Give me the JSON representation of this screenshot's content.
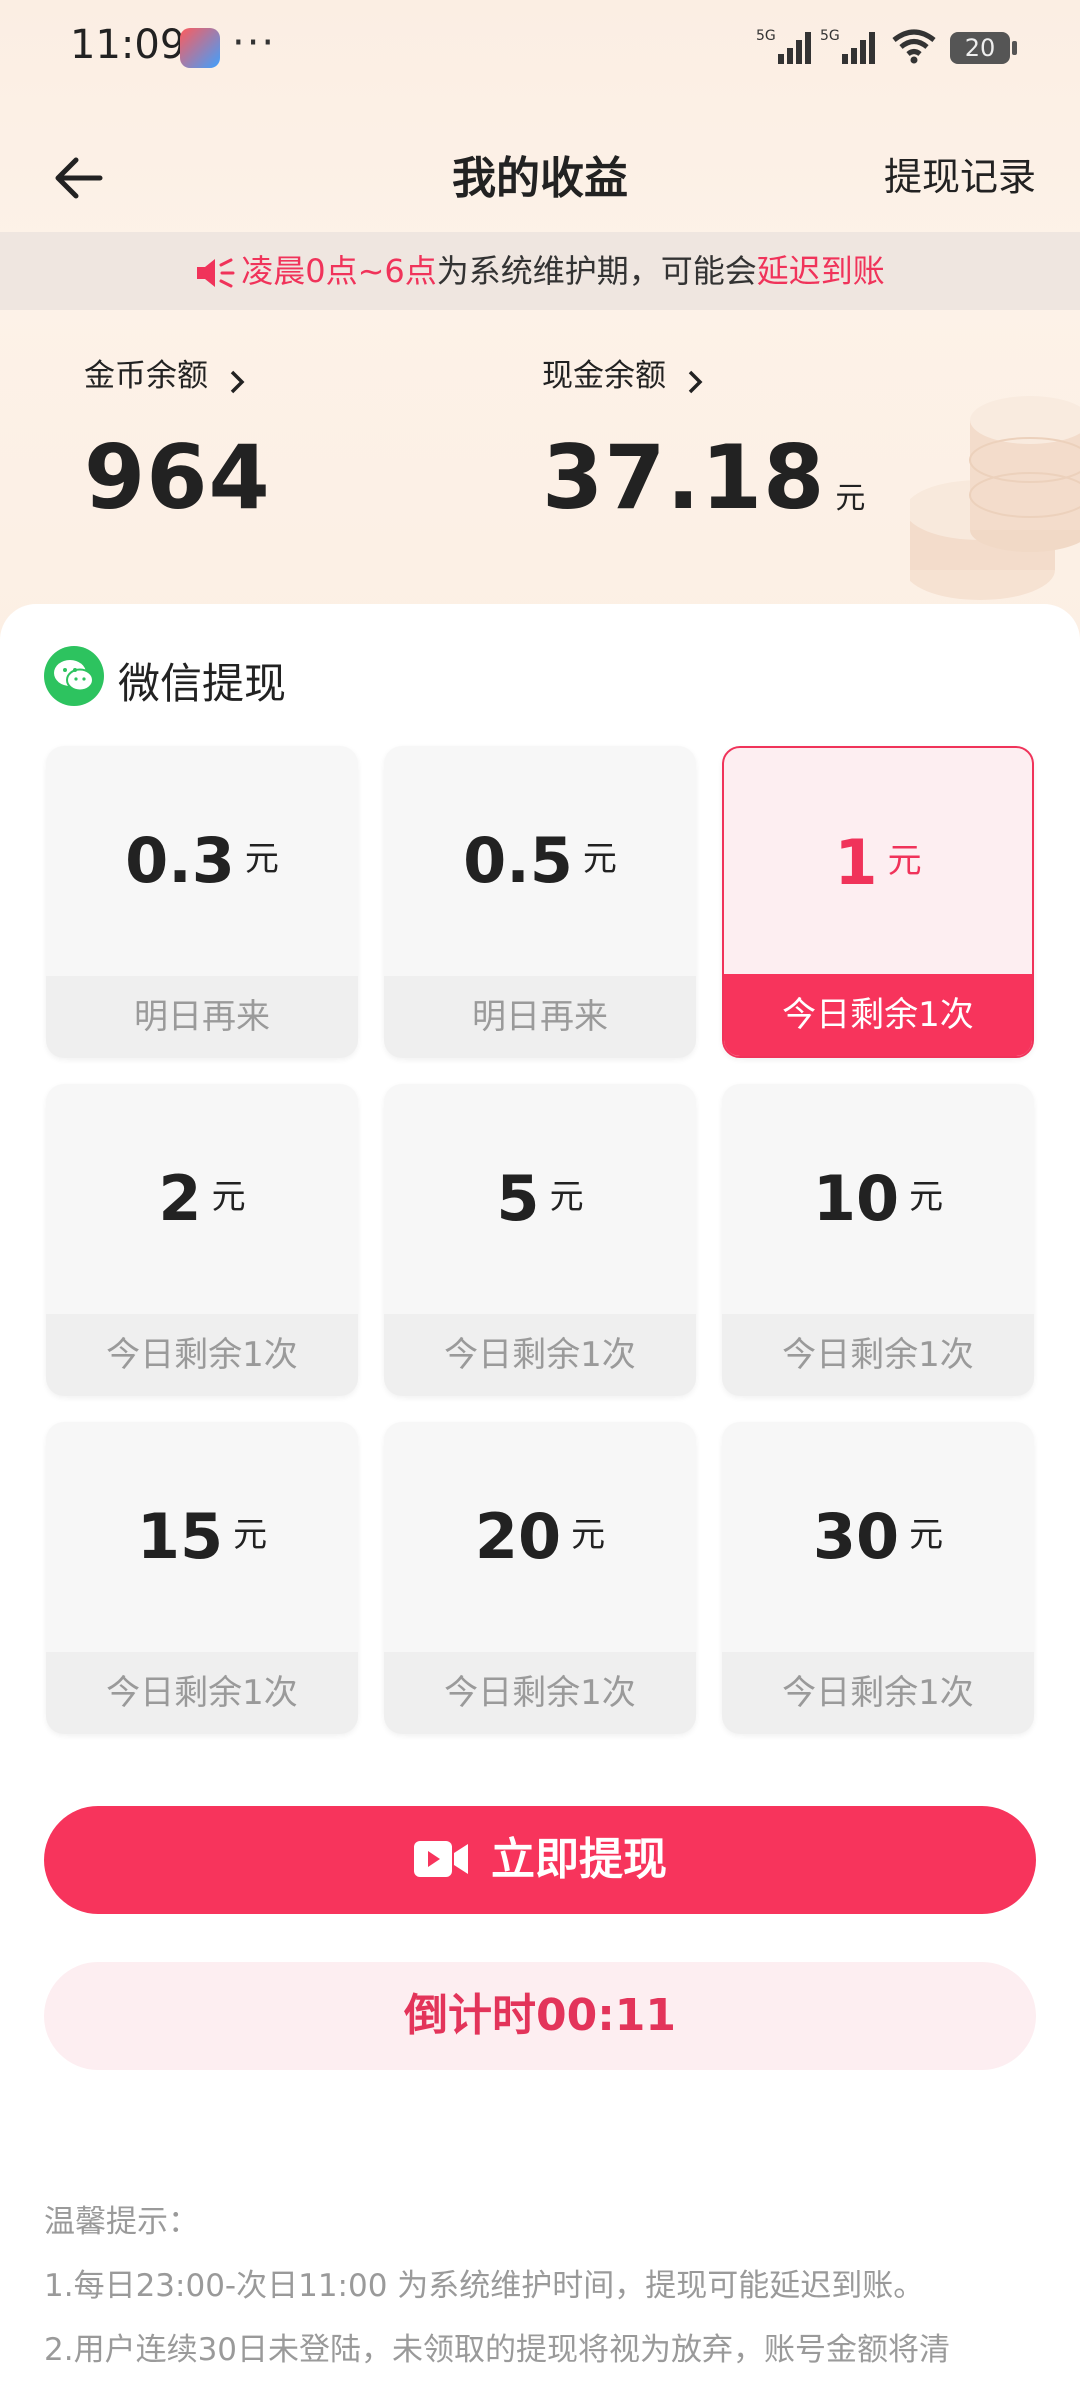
{
  "status_bar": {
    "time": "11:09",
    "more": "···",
    "battery": "20",
    "network_a": "5G",
    "network_b": "5G"
  },
  "header": {
    "title": "我的收益",
    "action": "提现记录"
  },
  "notice": {
    "part1": "凌晨0点~6点",
    "part2": "为系统维护期，可能会",
    "part3": "延迟到账"
  },
  "balances": {
    "coin_label": "金币余额",
    "coin_value": "964",
    "cash_label": "现金余额",
    "cash_value": "37.18",
    "cash_unit": "元"
  },
  "withdraw": {
    "title": "微信提现",
    "options": [
      {
        "amount": "0.3",
        "unit": "元",
        "status": "明日再来"
      },
      {
        "amount": "0.5",
        "unit": "元",
        "status": "明日再来"
      },
      {
        "amount": "1",
        "unit": "元",
        "status": "今日剩余1次",
        "selected": true
      },
      {
        "amount": "2",
        "unit": "元",
        "status": "今日剩余1次"
      },
      {
        "amount": "5",
        "unit": "元",
        "status": "今日剩余1次"
      },
      {
        "amount": "10",
        "unit": "元",
        "status": "今日剩余1次"
      },
      {
        "amount": "15",
        "unit": "元",
        "status": "今日剩余1次"
      },
      {
        "amount": "20",
        "unit": "元",
        "status": "今日剩余1次"
      },
      {
        "amount": "30",
        "unit": "元",
        "status": "今日剩余1次"
      }
    ],
    "primary_button": "立即提现",
    "countdown_button": "倒计时00:11"
  },
  "tips": {
    "title": "温馨提示：",
    "line1": "1.每日23:00-次日11:00 为系统维护时间，提现可能延迟到账。",
    "line2": "2.用户连续30日未登陆，未领取的提现将视为放弃，账号金额将清"
  },
  "colors": {
    "accent": "#f7345c",
    "accent_light": "#fdeef1",
    "wechat": "#2dc35f"
  }
}
